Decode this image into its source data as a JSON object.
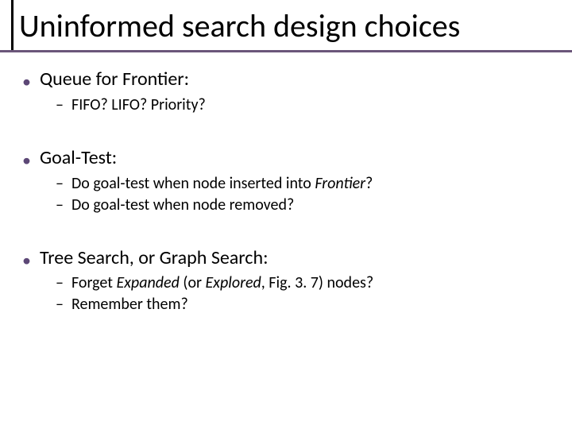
{
  "title": "Uninformed search design choices",
  "sections": [
    {
      "heading": "Queue for Frontier:",
      "items": [
        {
          "text": "FIFO? LIFO? Priority?"
        }
      ]
    },
    {
      "heading": "Goal-Test:",
      "items": [
        {
          "prefix": "Do goal-test when node inserted into ",
          "italic": "Frontier",
          "suffix": "?"
        },
        {
          "prefix": "Do goal-test when node removed?",
          "italic": "",
          "suffix": ""
        }
      ]
    },
    {
      "heading": "Tree Search, or Graph Search:",
      "items": [
        {
          "prefix": "Forget ",
          "italic": "Expanded",
          "mid": " (or ",
          "italic2": "Explored",
          "suffix": ", Fig. 3. 7) nodes?"
        },
        {
          "prefix": "Remember them?",
          "italic": "",
          "suffix": ""
        }
      ]
    }
  ]
}
